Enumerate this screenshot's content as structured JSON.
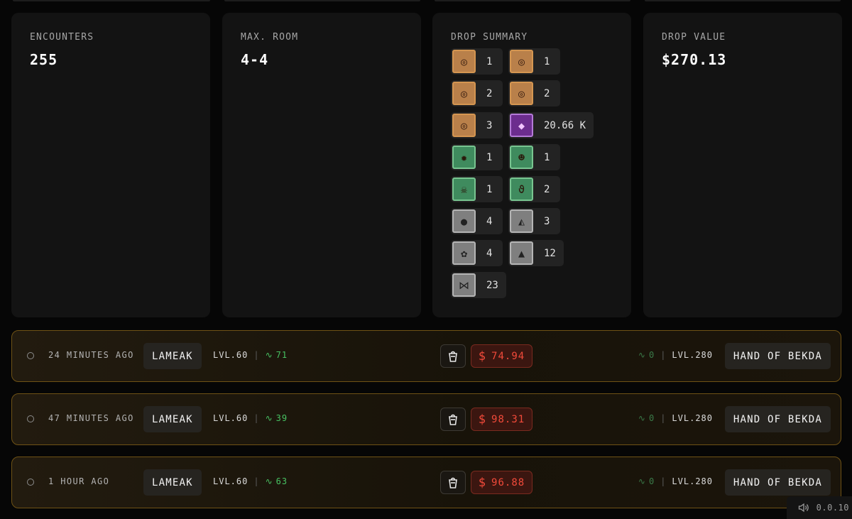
{
  "stats": {
    "encounters": {
      "label": "ENCOUNTERS",
      "value": "255"
    },
    "max_room": {
      "label": "MAX. ROOM",
      "value": "4-4"
    },
    "drop_summary": {
      "label": "DROP SUMMARY",
      "rows": [
        [
          {
            "icon": "ring-icon",
            "glyph": "◎",
            "tier": "gold",
            "qty": "1"
          },
          {
            "icon": "ring-icon",
            "glyph": "◎",
            "tier": "gold",
            "qty": "1"
          }
        ],
        [
          {
            "icon": "ring-icon",
            "glyph": "◎",
            "tier": "gold",
            "qty": "2"
          },
          {
            "icon": "ring-icon",
            "glyph": "◎",
            "tier": "gold",
            "qty": "2"
          }
        ],
        [
          {
            "icon": "ring-icon",
            "glyph": "◎",
            "tier": "gold",
            "qty": "3"
          },
          {
            "icon": "gems-icon",
            "glyph": "◆",
            "tier": "purple",
            "qty": "20.66 K"
          }
        ],
        [
          {
            "icon": "creature-icon",
            "glyph": "✹",
            "tier": "green",
            "qty": "1"
          },
          {
            "icon": "monkey-icon",
            "glyph": "☻",
            "tier": "green",
            "qty": "1"
          }
        ],
        [
          {
            "icon": "skull-icon",
            "glyph": "☠",
            "tier": "green",
            "qty": "1"
          },
          {
            "icon": "worm-icon",
            "glyph": "ϑ",
            "tier": "green",
            "qty": "2"
          }
        ],
        [
          {
            "icon": "coal-icon",
            "glyph": "●",
            "tier": "grey",
            "qty": "4"
          },
          {
            "icon": "ore-icon",
            "glyph": "◭",
            "tier": "grey",
            "qty": "3"
          }
        ],
        [
          {
            "icon": "herb-icon",
            "glyph": "✿",
            "tier": "grey",
            "qty": "4"
          },
          {
            "icon": "stone-icon",
            "glyph": "▲",
            "tier": "grey",
            "qty": "12"
          }
        ],
        [
          {
            "icon": "bones-icon",
            "glyph": "⋈",
            "tier": "grey",
            "qty": "23"
          }
        ]
      ]
    },
    "drop_value": {
      "label": "DROP VALUE",
      "value": "$270.13"
    }
  },
  "encounters": [
    {
      "time": "24 MINUTES AGO",
      "player": "LAMEAK",
      "player_level": "LVL.60",
      "player_power": "71",
      "price_currency": "$",
      "price": "74.94",
      "monster_power": "0",
      "monster_level": "LVL.280",
      "monster": "HAND OF BEKDA"
    },
    {
      "time": "47 MINUTES AGO",
      "player": "LAMEAK",
      "player_level": "LVL.60",
      "player_power": "39",
      "price_currency": "$",
      "price": "98.31",
      "monster_power": "0",
      "monster_level": "LVL.280",
      "monster": "HAND OF BEKDA"
    },
    {
      "time": "1 HOUR AGO",
      "player": "LAMEAK",
      "player_level": "LVL.60",
      "player_power": "63",
      "price_currency": "$",
      "price": "96.88",
      "monster_power": "0",
      "monster_level": "LVL.280",
      "monster": "HAND OF BEKDA"
    }
  ],
  "footer": {
    "version": "0.0.10",
    "sound_icon": "speaker-icon"
  },
  "colors": {
    "gold_border": "#6f5215",
    "price_red": "#f24a3a",
    "pulse_green": "#47c162",
    "card_bg": "#131313"
  }
}
